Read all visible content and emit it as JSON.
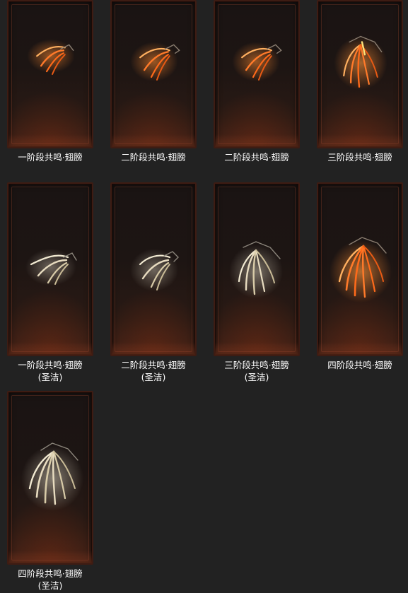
{
  "gallery": {
    "items": [
      {
        "label": "一阶段共鸣·翅膀",
        "sublabel": "",
        "icon": "resonance-wings-stage1-icon",
        "tone": "fire"
      },
      {
        "label": "二阶段共鸣·翅膀",
        "sublabel": "",
        "icon": "resonance-wings-stage2-icon",
        "tone": "fire"
      },
      {
        "label": "二阶段共鸣·翅膀",
        "sublabel": "",
        "icon": "resonance-wings-stage2-icon",
        "tone": "fire"
      },
      {
        "label": "三阶段共鸣·翅膀",
        "sublabel": "",
        "icon": "resonance-wings-stage3-icon",
        "tone": "fire"
      },
      {
        "label": "一阶段共鸣·翅膀",
        "sublabel": "(圣洁)",
        "icon": "resonance-wings-stage1-holy-icon",
        "tone": "holy"
      },
      {
        "label": "二阶段共鸣·翅膀",
        "sublabel": "(圣洁)",
        "icon": "resonance-wings-stage2-holy-icon",
        "tone": "holy"
      },
      {
        "label": "三阶段共鸣·翅膀",
        "sublabel": "(圣洁)",
        "icon": "resonance-wings-stage3-holy-icon",
        "tone": "holy"
      },
      {
        "label": "四阶段共鸣·翅膀",
        "sublabel": "",
        "icon": "resonance-wings-stage4-icon",
        "tone": "fire"
      },
      {
        "label": "四阶段共鸣·翅膀",
        "sublabel": "(圣洁)",
        "icon": "resonance-wings-stage4-holy-icon",
        "tone": "holy"
      }
    ],
    "colors": {
      "background": "#222222",
      "fire_primary": "#ff7a2a",
      "fire_glow": "#ffb060",
      "holy_primary": "#f2ead2",
      "holy_glow": "#fff7e0",
      "frame": "#3e1c13"
    }
  }
}
